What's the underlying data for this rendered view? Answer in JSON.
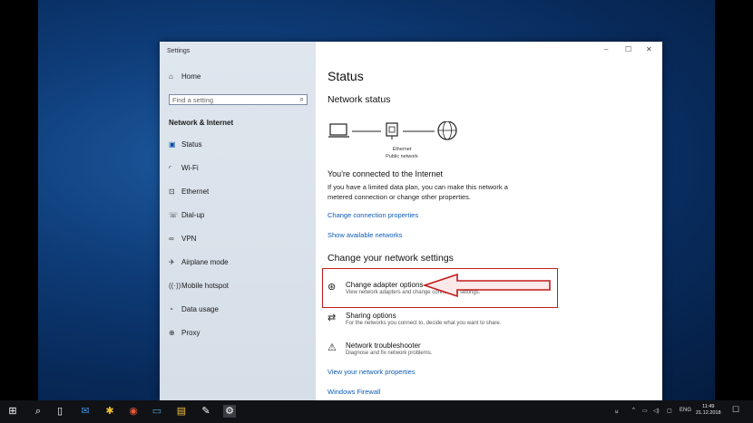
{
  "window": {
    "title": "Settings",
    "controls": {
      "minimize": "–",
      "maximize": "☐",
      "close": "✕"
    }
  },
  "sidebar": {
    "home_label": "Home",
    "search": {
      "placeholder": "Find a setting"
    },
    "section_title": "Network & Internet",
    "items": [
      {
        "label": "Status",
        "icon": "status-icon"
      },
      {
        "label": "Wi-Fi",
        "icon": "wifi-icon"
      },
      {
        "label": "Ethernet",
        "icon": "ethernet-icon"
      },
      {
        "label": "Dial-up",
        "icon": "dialup-icon"
      },
      {
        "label": "VPN",
        "icon": "vpn-icon"
      },
      {
        "label": "Airplane mode",
        "icon": "airplane-icon"
      },
      {
        "label": "Mobile hotspot",
        "icon": "hotspot-icon"
      },
      {
        "label": "Data usage",
        "icon": "data-usage-icon"
      },
      {
        "label": "Proxy",
        "icon": "globe-icon"
      }
    ]
  },
  "main": {
    "title": "Status",
    "network_status_heading": "Network status",
    "diagram": {
      "device_label": "Ethernet",
      "network_label": "Public network"
    },
    "connected_heading": "You're connected to the Internet",
    "connected_body": "If you have a limited data plan, you can make this network a metered connection or change other properties.",
    "link_change_properties": "Change connection properties",
    "link_show_networks": "Show available networks",
    "change_settings_heading": "Change your network settings",
    "options": [
      {
        "title": "Change adapter options",
        "desc": "View network adapters and change connection settings."
      },
      {
        "title": "Sharing options",
        "desc": "For the networks you connect to, decide what you want to share."
      },
      {
        "title": "Network troubleshooter",
        "desc": "Diagnose and fix network problems."
      }
    ],
    "link_view_properties": "View your network properties",
    "link_firewall": "Windows Firewall"
  },
  "annotation": {
    "color": "#c21b1b"
  },
  "taskbar": {
    "language": "ENG",
    "time": "11:49",
    "date": "21.12.2018"
  }
}
